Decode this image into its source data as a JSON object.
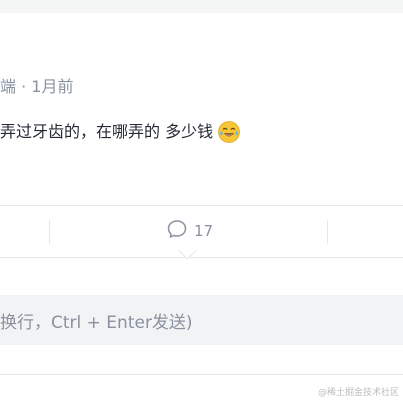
{
  "comment": {
    "meta": "端 · 1月前",
    "text": "弄过牙齿的，在哪弄的 多少钱",
    "emoji_icon": "tears-of-joy-emoji"
  },
  "actions": {
    "comment_count": "17",
    "comment_icon": "comment-bubble-icon"
  },
  "input": {
    "placeholder": "换行，Ctrl + Enter发送)"
  },
  "watermark": "@稀土掘金技术社区",
  "colors": {
    "background": "#f4f5f5",
    "card": "#ffffff",
    "text_primary": "#252933",
    "text_secondary": "#8a919f",
    "border": "#e4e6eb",
    "input_bg": "#f2f3f5"
  }
}
